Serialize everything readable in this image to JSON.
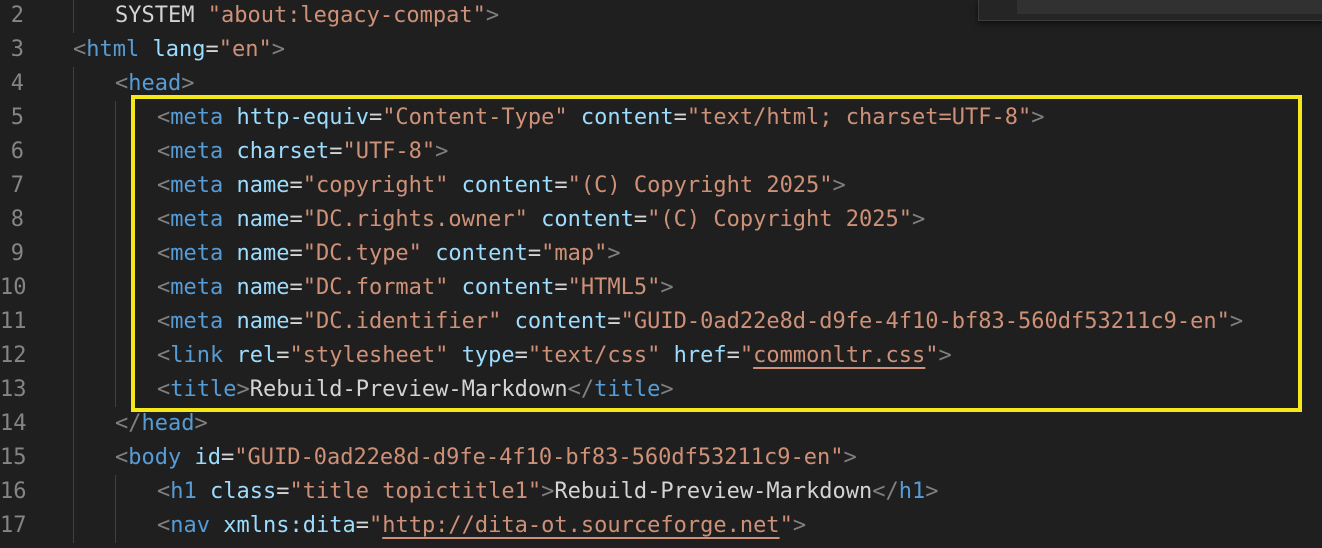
{
  "editor": {
    "lines": [
      {
        "num": "2",
        "indent": 1,
        "tokens": [
          {
            "t": "txt",
            "v": "SYSTEM "
          },
          {
            "t": "str",
            "v": "\"about:legacy-compat\""
          },
          {
            "t": "brk",
            "v": ">"
          }
        ]
      },
      {
        "num": "3",
        "indent": 0,
        "tokens": [
          {
            "t": "brk",
            "v": "<"
          },
          {
            "t": "tag",
            "v": "html"
          },
          {
            "t": "txt",
            "v": " "
          },
          {
            "t": "attr",
            "v": "lang"
          },
          {
            "t": "eq",
            "v": "="
          },
          {
            "t": "str",
            "v": "\"en\""
          },
          {
            "t": "brk",
            "v": ">"
          }
        ]
      },
      {
        "num": "4",
        "indent": 1,
        "tokens": [
          {
            "t": "brk",
            "v": "<"
          },
          {
            "t": "tag",
            "v": "head"
          },
          {
            "t": "brk",
            "v": ">"
          }
        ]
      },
      {
        "num": "5",
        "indent": 2,
        "tokens": [
          {
            "t": "brk",
            "v": "<"
          },
          {
            "t": "tag",
            "v": "meta"
          },
          {
            "t": "txt",
            "v": " "
          },
          {
            "t": "attr",
            "v": "http-equiv"
          },
          {
            "t": "eq",
            "v": "="
          },
          {
            "t": "str",
            "v": "\"Content-Type\""
          },
          {
            "t": "txt",
            "v": " "
          },
          {
            "t": "attr",
            "v": "content"
          },
          {
            "t": "eq",
            "v": "="
          },
          {
            "t": "str",
            "v": "\"text/html; charset=UTF-8\""
          },
          {
            "t": "brk",
            "v": ">"
          }
        ]
      },
      {
        "num": "6",
        "indent": 2,
        "tokens": [
          {
            "t": "brk",
            "v": "<"
          },
          {
            "t": "tag",
            "v": "meta"
          },
          {
            "t": "txt",
            "v": " "
          },
          {
            "t": "attr",
            "v": "charset"
          },
          {
            "t": "eq",
            "v": "="
          },
          {
            "t": "str",
            "v": "\"UTF-8\""
          },
          {
            "t": "brk",
            "v": ">"
          }
        ]
      },
      {
        "num": "7",
        "indent": 2,
        "tokens": [
          {
            "t": "brk",
            "v": "<"
          },
          {
            "t": "tag",
            "v": "meta"
          },
          {
            "t": "txt",
            "v": " "
          },
          {
            "t": "attr",
            "v": "name"
          },
          {
            "t": "eq",
            "v": "="
          },
          {
            "t": "str",
            "v": "\"copyright\""
          },
          {
            "t": "txt",
            "v": " "
          },
          {
            "t": "attr",
            "v": "content"
          },
          {
            "t": "eq",
            "v": "="
          },
          {
            "t": "str",
            "v": "\"(C) Copyright 2025\""
          },
          {
            "t": "brk",
            "v": ">"
          }
        ]
      },
      {
        "num": "8",
        "indent": 2,
        "tokens": [
          {
            "t": "brk",
            "v": "<"
          },
          {
            "t": "tag",
            "v": "meta"
          },
          {
            "t": "txt",
            "v": " "
          },
          {
            "t": "attr",
            "v": "name"
          },
          {
            "t": "eq",
            "v": "="
          },
          {
            "t": "str",
            "v": "\"DC.rights.owner\""
          },
          {
            "t": "txt",
            "v": " "
          },
          {
            "t": "attr",
            "v": "content"
          },
          {
            "t": "eq",
            "v": "="
          },
          {
            "t": "str",
            "v": "\"(C) Copyright 2025\""
          },
          {
            "t": "brk",
            "v": ">"
          }
        ]
      },
      {
        "num": "9",
        "indent": 2,
        "tokens": [
          {
            "t": "brk",
            "v": "<"
          },
          {
            "t": "tag",
            "v": "meta"
          },
          {
            "t": "txt",
            "v": " "
          },
          {
            "t": "attr",
            "v": "name"
          },
          {
            "t": "eq",
            "v": "="
          },
          {
            "t": "str",
            "v": "\"DC.type\""
          },
          {
            "t": "txt",
            "v": " "
          },
          {
            "t": "attr",
            "v": "content"
          },
          {
            "t": "eq",
            "v": "="
          },
          {
            "t": "str",
            "v": "\"map\""
          },
          {
            "t": "brk",
            "v": ">"
          }
        ]
      },
      {
        "num": "10",
        "indent": 2,
        "tokens": [
          {
            "t": "brk",
            "v": "<"
          },
          {
            "t": "tag",
            "v": "meta"
          },
          {
            "t": "txt",
            "v": " "
          },
          {
            "t": "attr",
            "v": "name"
          },
          {
            "t": "eq",
            "v": "="
          },
          {
            "t": "str",
            "v": "\"DC.format\""
          },
          {
            "t": "txt",
            "v": " "
          },
          {
            "t": "attr",
            "v": "content"
          },
          {
            "t": "eq",
            "v": "="
          },
          {
            "t": "str",
            "v": "\"HTML5\""
          },
          {
            "t": "brk",
            "v": ">"
          }
        ]
      },
      {
        "num": "11",
        "indent": 2,
        "tokens": [
          {
            "t": "brk",
            "v": "<"
          },
          {
            "t": "tag",
            "v": "meta"
          },
          {
            "t": "txt",
            "v": " "
          },
          {
            "t": "attr",
            "v": "name"
          },
          {
            "t": "eq",
            "v": "="
          },
          {
            "t": "str",
            "v": "\"DC.identifier\""
          },
          {
            "t": "txt",
            "v": " "
          },
          {
            "t": "attr",
            "v": "content"
          },
          {
            "t": "eq",
            "v": "="
          },
          {
            "t": "str",
            "v": "\"GUID-0ad22e8d-d9fe-4f10-bf83-560df53211c9-en\""
          },
          {
            "t": "brk",
            "v": ">"
          }
        ]
      },
      {
        "num": "12",
        "indent": 2,
        "tokens": [
          {
            "t": "brk",
            "v": "<"
          },
          {
            "t": "tag",
            "v": "link"
          },
          {
            "t": "txt",
            "v": " "
          },
          {
            "t": "attr",
            "v": "rel"
          },
          {
            "t": "eq",
            "v": "="
          },
          {
            "t": "str",
            "v": "\"stylesheet\""
          },
          {
            "t": "txt",
            "v": " "
          },
          {
            "t": "attr",
            "v": "type"
          },
          {
            "t": "eq",
            "v": "="
          },
          {
            "t": "str",
            "v": "\"text/css\""
          },
          {
            "t": "txt",
            "v": " "
          },
          {
            "t": "attr",
            "v": "href"
          },
          {
            "t": "eq",
            "v": "="
          },
          {
            "t": "str",
            "v": "\""
          },
          {
            "t": "str",
            "v": "commonltr.css",
            "link": true
          },
          {
            "t": "str",
            "v": "\""
          },
          {
            "t": "brk",
            "v": ">"
          }
        ]
      },
      {
        "num": "13",
        "indent": 2,
        "tokens": [
          {
            "t": "brk",
            "v": "<"
          },
          {
            "t": "tag",
            "v": "title"
          },
          {
            "t": "brk",
            "v": ">"
          },
          {
            "t": "txt",
            "v": "Rebuild-Preview-Markdown"
          },
          {
            "t": "brk",
            "v": "</"
          },
          {
            "t": "tag",
            "v": "title"
          },
          {
            "t": "brk",
            "v": ">"
          }
        ]
      },
      {
        "num": "14",
        "indent": 1,
        "tokens": [
          {
            "t": "brk",
            "v": "</"
          },
          {
            "t": "tag",
            "v": "head"
          },
          {
            "t": "brk",
            "v": ">"
          }
        ]
      },
      {
        "num": "15",
        "indent": 1,
        "tokens": [
          {
            "t": "brk",
            "v": "<"
          },
          {
            "t": "tag",
            "v": "body"
          },
          {
            "t": "txt",
            "v": " "
          },
          {
            "t": "attr",
            "v": "id"
          },
          {
            "t": "eq",
            "v": "="
          },
          {
            "t": "str",
            "v": "\"GUID-0ad22e8d-d9fe-4f10-bf83-560df53211c9-en\""
          },
          {
            "t": "brk",
            "v": ">"
          }
        ]
      },
      {
        "num": "16",
        "indent": 2,
        "tokens": [
          {
            "t": "brk",
            "v": "<"
          },
          {
            "t": "tag",
            "v": "h1"
          },
          {
            "t": "txt",
            "v": " "
          },
          {
            "t": "attr",
            "v": "class"
          },
          {
            "t": "eq",
            "v": "="
          },
          {
            "t": "str",
            "v": "\"title topictitle1\""
          },
          {
            "t": "brk",
            "v": ">"
          },
          {
            "t": "txt",
            "v": "Rebuild-Preview-Markdown"
          },
          {
            "t": "brk",
            "v": "</"
          },
          {
            "t": "tag",
            "v": "h1"
          },
          {
            "t": "brk",
            "v": ">"
          }
        ]
      },
      {
        "num": "17",
        "indent": 2,
        "tokens": [
          {
            "t": "brk",
            "v": "<"
          },
          {
            "t": "tag",
            "v": "nav"
          },
          {
            "t": "txt",
            "v": " "
          },
          {
            "t": "attr",
            "v": "xmlns:dita"
          },
          {
            "t": "eq",
            "v": "="
          },
          {
            "t": "str",
            "v": "\""
          },
          {
            "t": "str",
            "v": "http://dita-ot.sourceforge.net",
            "link": true
          },
          {
            "t": "str",
            "v": "\""
          },
          {
            "t": "brk",
            "v": ">"
          }
        ]
      }
    ]
  },
  "colors": {
    "background": "#1f1f1f",
    "line_number": "#858585",
    "tag": "#569cd6",
    "attribute": "#9cdcfe",
    "string": "#ce9178",
    "bracket": "#808080",
    "text": "#d4d4d4",
    "highlight_border": "#f5e81a"
  }
}
